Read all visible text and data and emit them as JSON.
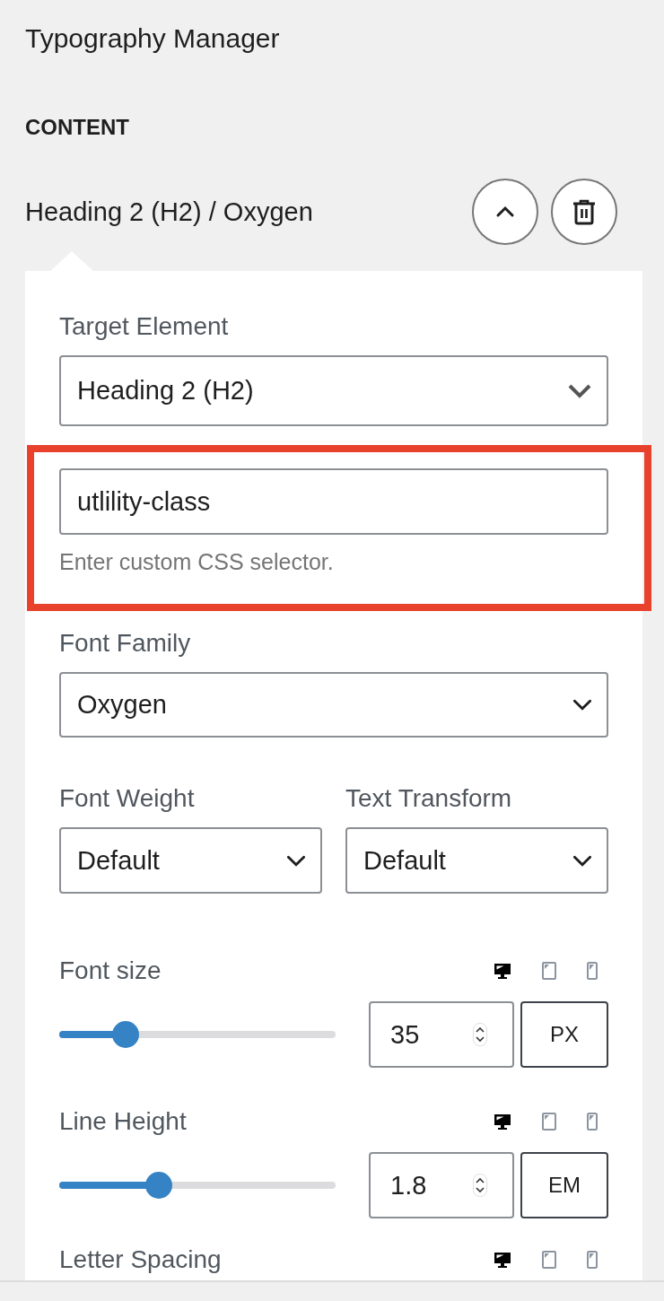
{
  "title": "Typography Manager",
  "section": "CONTENT",
  "item": {
    "label": "Heading 2 (H2) / Oxygen",
    "expanded": true
  },
  "target": {
    "label": "Target Element",
    "value": "Heading 2 (H2)"
  },
  "selector": {
    "value": "utlility-class",
    "help": "Enter custom CSS selector.",
    "highlighted": true
  },
  "font_family": {
    "label": "Font Family",
    "value": "Oxygen"
  },
  "font_weight": {
    "label": "Font Weight",
    "value": "Default"
  },
  "text_transform": {
    "label": "Text Transform",
    "value": "Default"
  },
  "sliders": [
    {
      "label": "Font size",
      "level": 0.24,
      "value": "35",
      "unit": "PX",
      "devices": [
        {
          "kind": "desktop",
          "selected": true
        },
        {
          "kind": "tablet",
          "selected": false
        },
        {
          "kind": "mobile",
          "selected": false
        }
      ]
    },
    {
      "label": "Line Height",
      "level": 0.36,
      "value": "1.8",
      "unit": "EM",
      "devices": [
        {
          "kind": "desktop",
          "selected": true
        },
        {
          "kind": "tablet",
          "selected": false
        },
        {
          "kind": "mobile",
          "selected": false
        }
      ]
    }
  ],
  "cut_row": {
    "label": "Letter Spacing",
    "devices": [
      {
        "kind": "desktop",
        "selected": true
      },
      {
        "kind": "tablet",
        "selected": false
      },
      {
        "kind": "mobile",
        "selected": false
      }
    ]
  }
}
